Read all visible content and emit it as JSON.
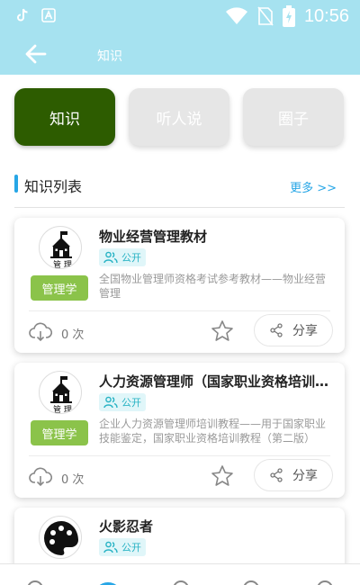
{
  "status": {
    "time": "10:56"
  },
  "header": {
    "title": "知识"
  },
  "tabs": [
    {
      "label": "知识",
      "active": true
    },
    {
      "label": "听人说",
      "active": false
    },
    {
      "label": "圈子",
      "active": false
    }
  ],
  "section": {
    "title": "知识列表",
    "more": "更多 >>"
  },
  "cards": [
    {
      "title": "物业经营管理教材",
      "public_label": "公开",
      "category": "管理学",
      "description": "全国物业管理师资格考试参考教材——物业经营管理",
      "downloads": "0 次",
      "share_label": "分享",
      "avatar_icon": "school-building-icon"
    },
    {
      "title": "人力资源管理师（国家职业资格培训教程）",
      "public_label": "公开",
      "category": "管理学",
      "description": "企业人力资源管理师培训教程——用于国家职业技能鉴定，国家职业资格培训教程（第二版）",
      "downloads": "0 次",
      "share_label": "分享",
      "avatar_icon": "school-building-icon"
    },
    {
      "title": "火影忍者",
      "public_label": "公开",
      "avatar_icon": "palette-icon"
    }
  ],
  "colors": {
    "header_bg": "#a6e2f0",
    "tab_active": "#2d5c00",
    "accent": "#27a6e6",
    "category_badge": "#8bc34a",
    "public_badge_text": "#28b3c4"
  }
}
